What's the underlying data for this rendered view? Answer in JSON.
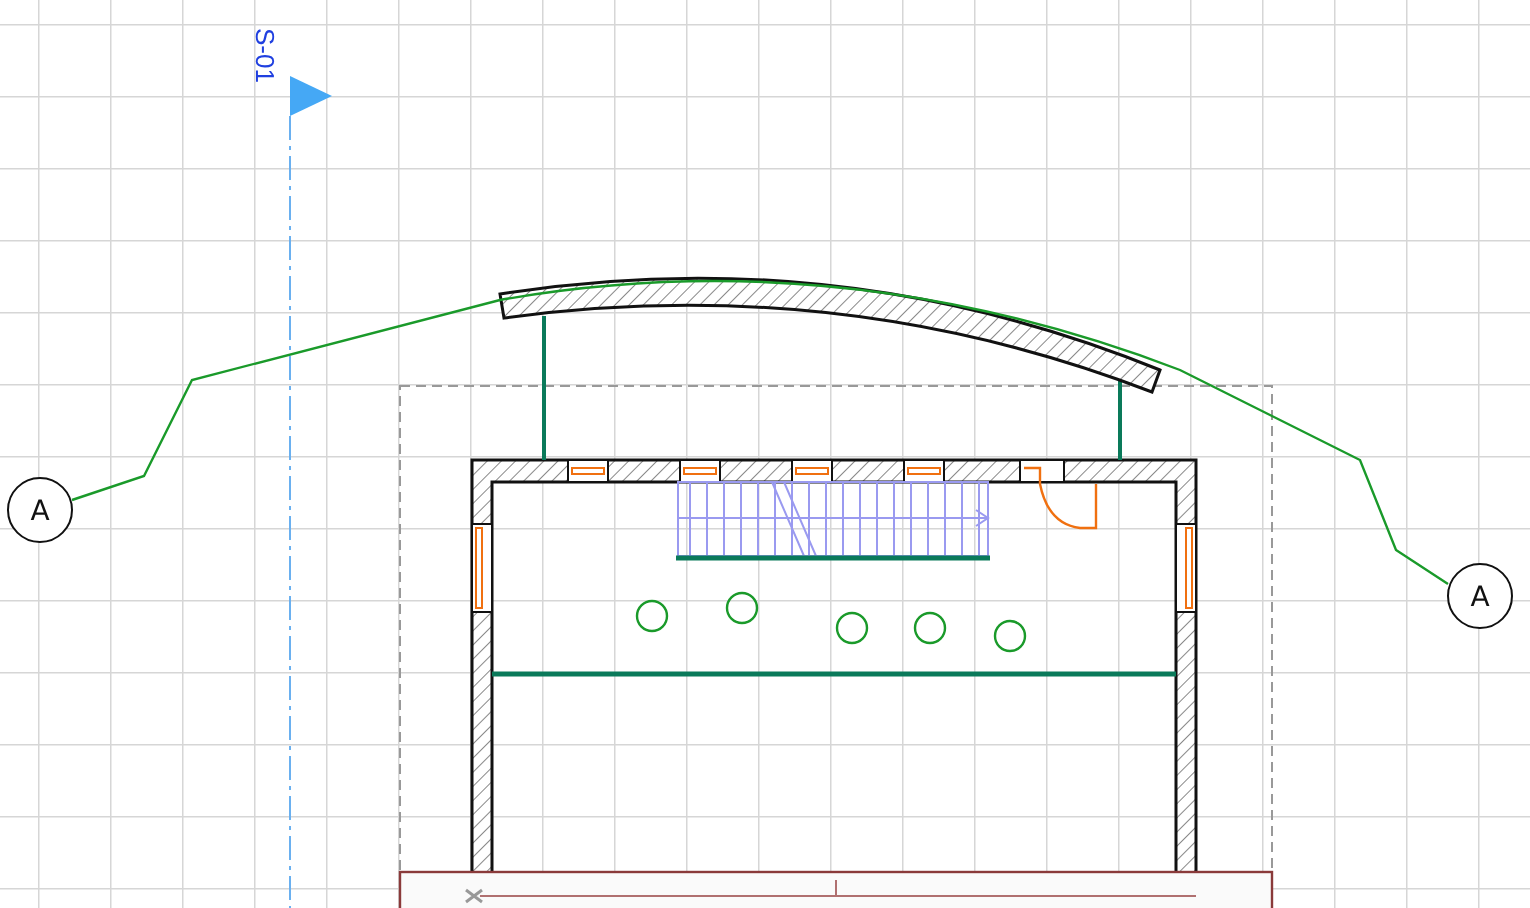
{
  "section_marker": {
    "label": "S-01"
  },
  "section_line": {
    "bubbles": [
      {
        "label": "A"
      },
      {
        "label": "A"
      }
    ]
  }
}
